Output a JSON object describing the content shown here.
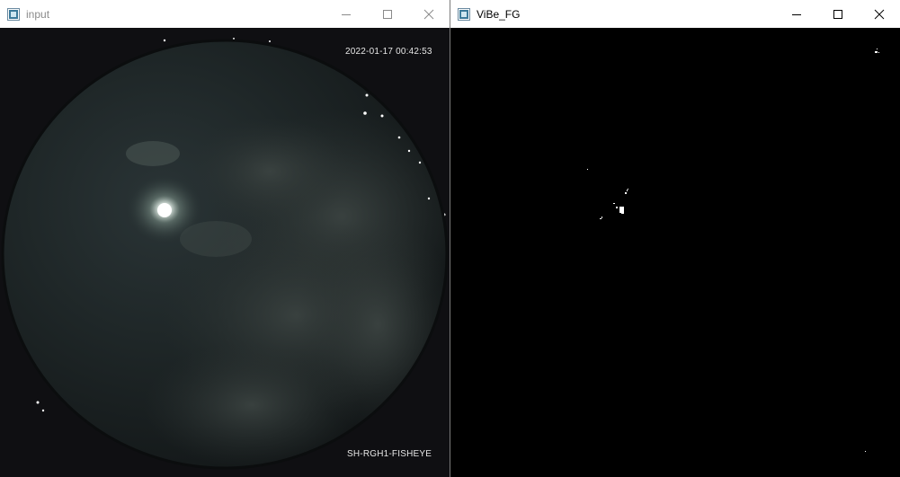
{
  "windows": [
    {
      "title": "input",
      "icons": [
        "opencv-window-icon",
        "minimize-icon",
        "maximize-icon",
        "close-icon"
      ],
      "overlay": {
        "timestamp": "2022-01-17 00:42:53",
        "camera_name": "SH-RGH1-FISHEYE"
      }
    },
    {
      "title": "ViBe_FG",
      "icons": [
        "opencv-window-icon",
        "minimize-icon",
        "maximize-icon",
        "close-icon"
      ]
    }
  ],
  "colors": {
    "titlebar_bg": "#ffffff",
    "inactive_title": "#8a8a8a",
    "active_title": "#000000",
    "sky_dark": "#101012",
    "foreground_mask": "#ffffff"
  }
}
